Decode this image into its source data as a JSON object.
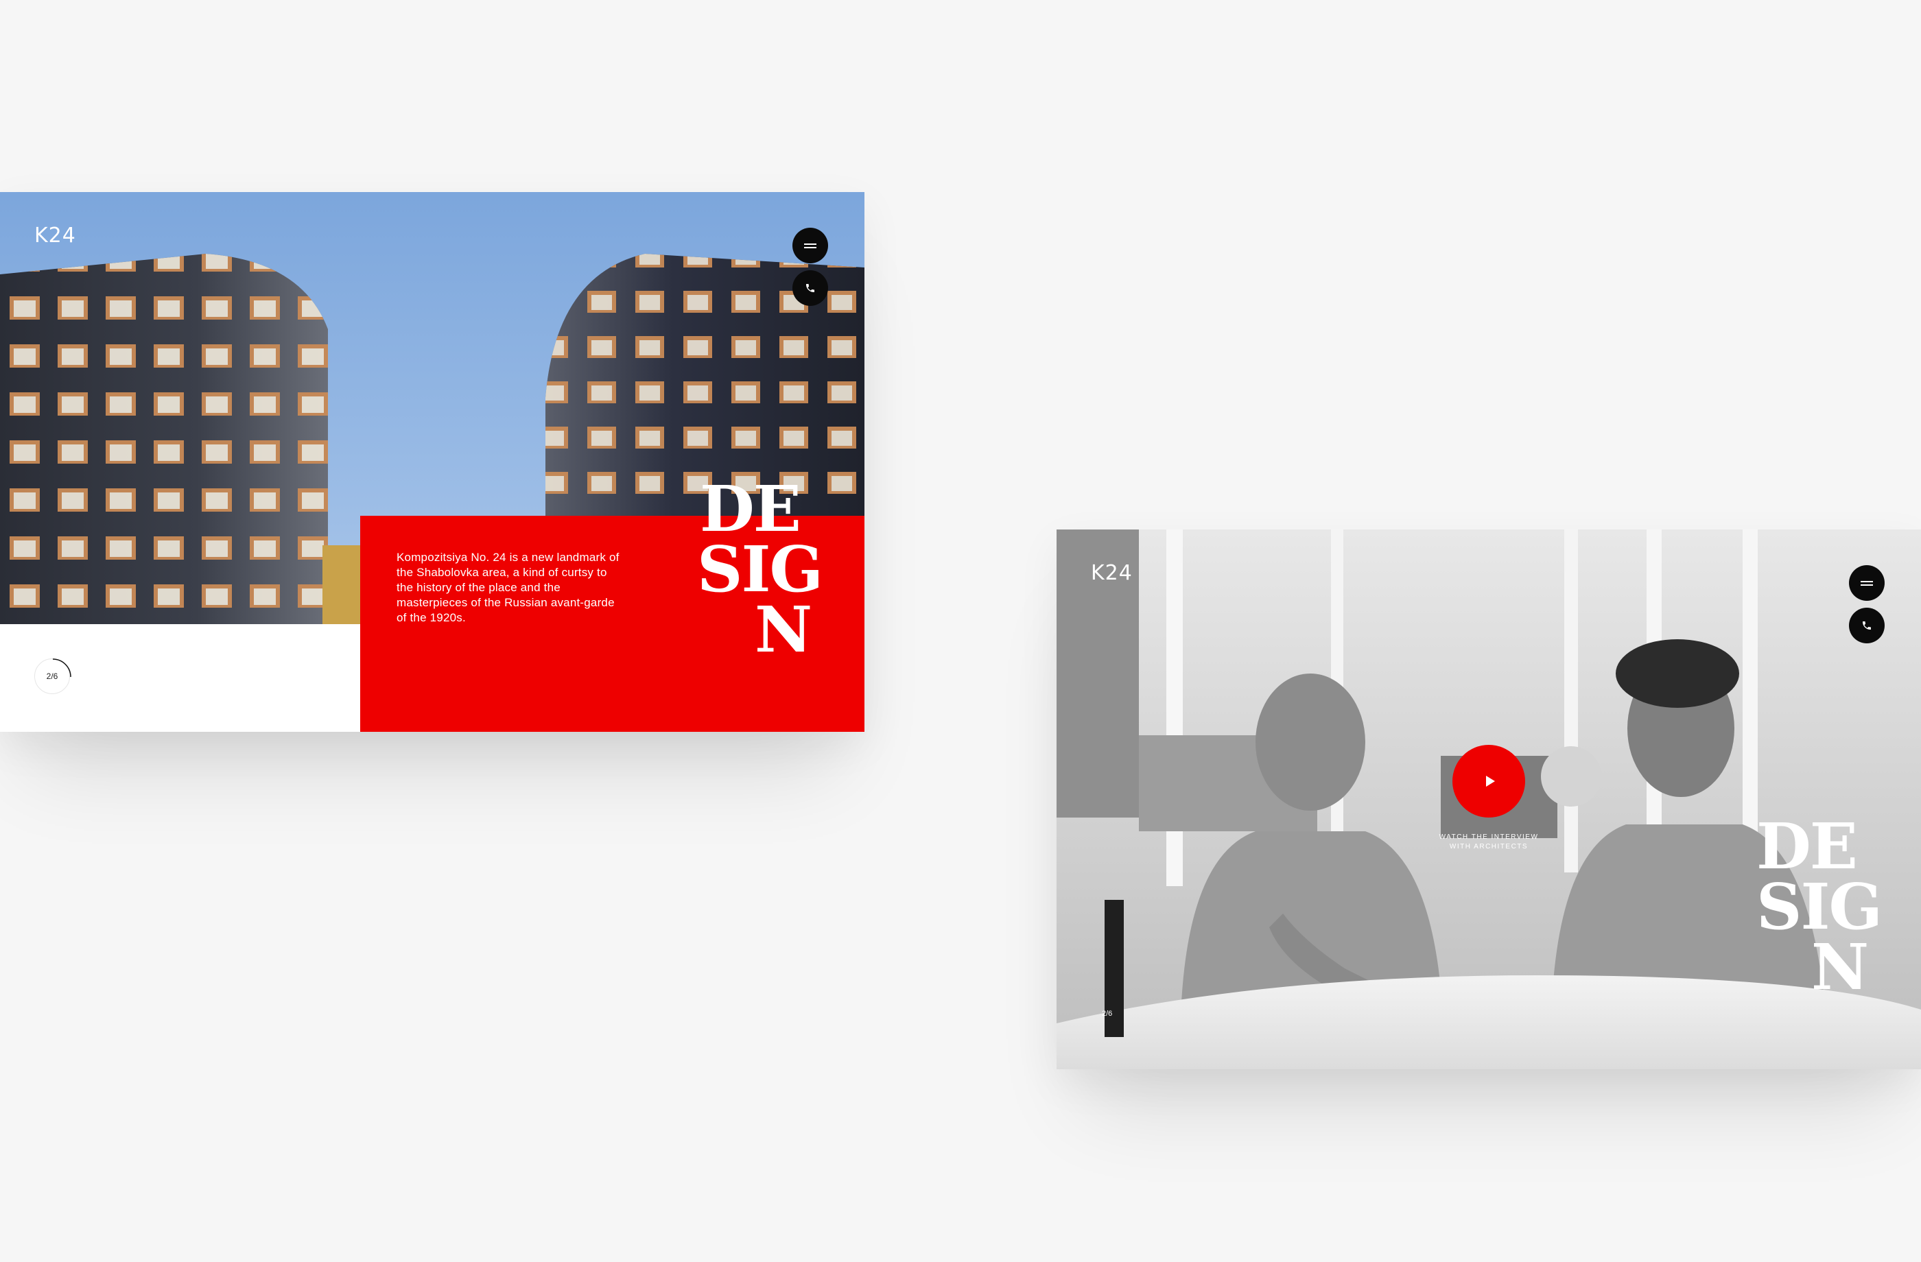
{
  "screens": [
    {
      "logo": "K24",
      "description": "Kompozitsiya No. 24 is a new landmark of the Shabolovka area, a kind of curtsy to the history of the place and the masterpieces of the Russian avant-garde of the 1920s.",
      "section_word": [
        "DE",
        "SIG",
        "N"
      ],
      "slide_counter": "2/6",
      "icons": {
        "menu": "menu-icon",
        "phone": "phone-icon"
      }
    },
    {
      "logo": "K24",
      "watch_caption": [
        "WATCH THE INTERVIEW",
        "WITH ARCHITECTS"
      ],
      "section_word": [
        "DE",
        "SIG",
        "N"
      ],
      "slide_counter": "2/6",
      "icons": {
        "menu": "menu-icon",
        "phone": "phone-icon",
        "play": "play-icon"
      }
    }
  ],
  "colors": {
    "accent_red": "#ee0000",
    "button_black": "#0b0b0b",
    "background": "#f6f6f6"
  }
}
